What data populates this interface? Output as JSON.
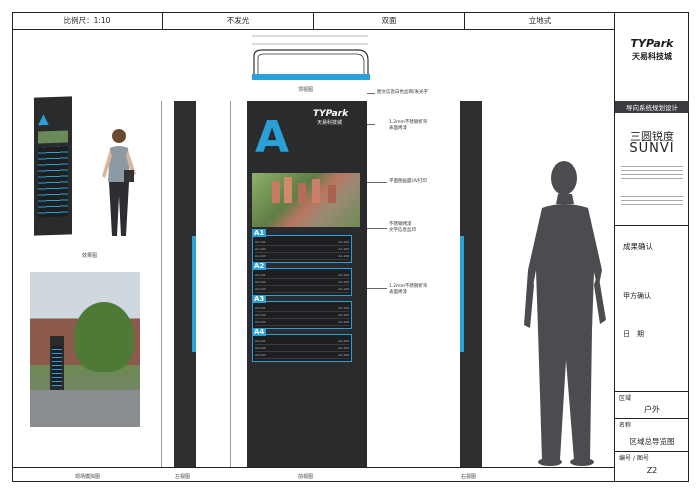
{
  "header": {
    "scale": "比例尺：1:10",
    "lighting": "不发光",
    "sides": "双面",
    "type": "立地式"
  },
  "titleblock": {
    "logo_text": "TYPark",
    "logo_sub": "天易科技城",
    "section_banner": "导向系统规划设计",
    "company_cn": "三圆锐度",
    "company_en": "SUNVI",
    "confirm_label": "成果确认",
    "party_a_label": "甲方确认",
    "date_label": "日　期",
    "area_label": "区域",
    "area_value": "户外",
    "name_label": "名称",
    "name_value": "区域总导览图",
    "code_label": "编号 / 图号",
    "code_value": "Z2"
  },
  "views": {
    "effect": "效果图",
    "site": "现场模拟图",
    "left": "左视图",
    "front": "前视图",
    "right": "右视图",
    "top": "顶视图"
  },
  "sign": {
    "logo_text": "TYPark",
    "logo_sub": "天易科技城",
    "big_letter": "A",
    "groups": [
      {
        "tag": "A1",
        "rows": [
          [
            "A1-101",
            "A1-104"
          ],
          [
            "A1-102",
            "A1-105"
          ],
          [
            "A1-103",
            "A1-106"
          ]
        ]
      },
      {
        "tag": "A2",
        "rows": [
          [
            "A2-101",
            "A2-104"
          ],
          [
            "A2-102",
            "A2-105"
          ],
          [
            "A2-103",
            "A2-106"
          ]
        ]
      },
      {
        "tag": "A3",
        "rows": [
          [
            "A3-101",
            "A3-104"
          ],
          [
            "A3-102",
            "A3-105"
          ],
          [
            "A3-103",
            "A3-106"
          ]
        ]
      },
      {
        "tag": "A4",
        "rows": [
          [
            "A4-101",
            "A4-104"
          ],
          [
            "A4-102",
            "A4-105"
          ],
          [
            "A4-103",
            "A4-106"
          ]
        ]
      }
    ]
  },
  "colors": {
    "accent": "#2a9fd8",
    "panel": "#2a2b2d",
    "figure": "#4a4c50"
  }
}
